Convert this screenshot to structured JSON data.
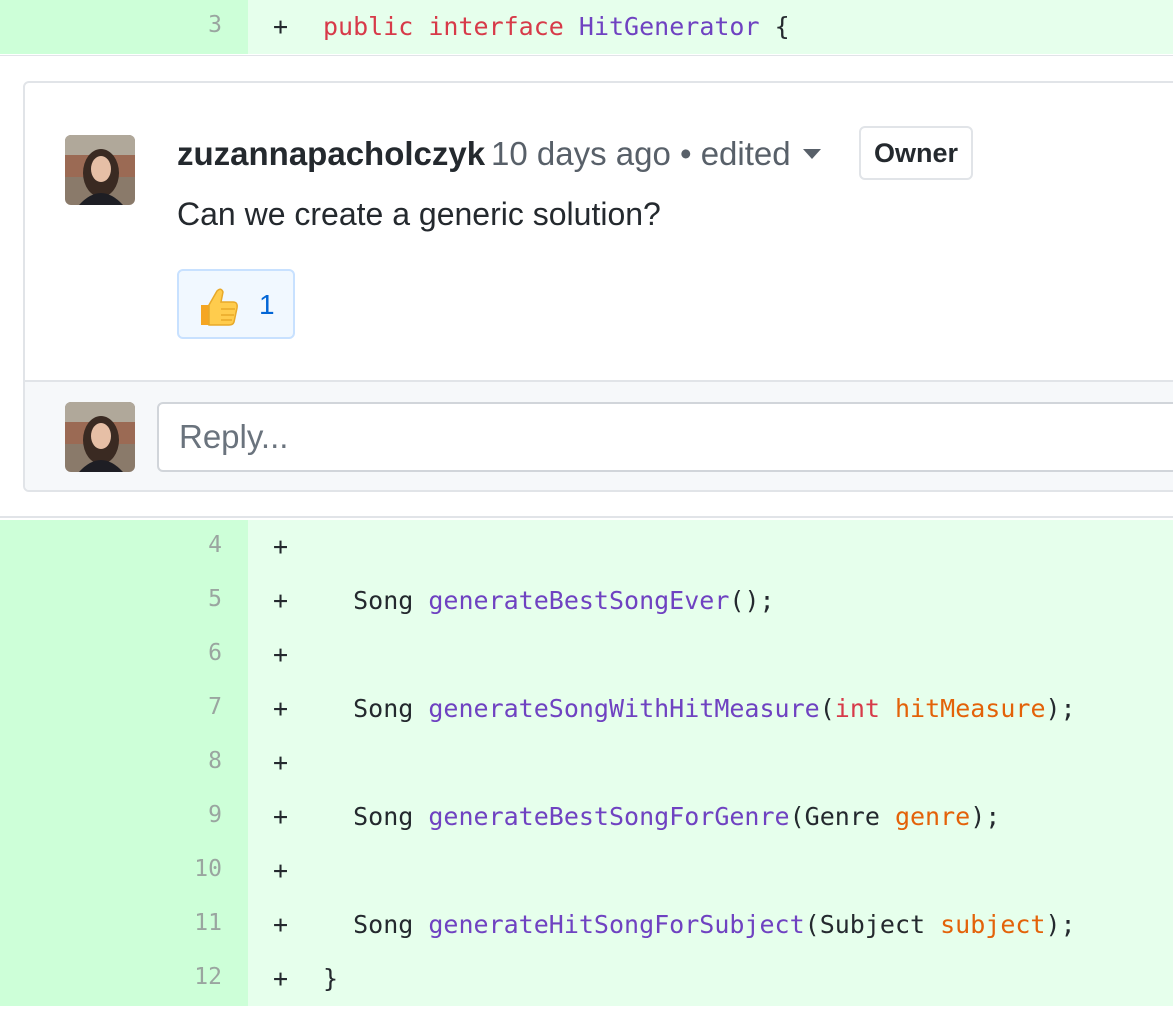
{
  "diff_top": {
    "line_number": "3",
    "marker": "+",
    "tokens": [
      {
        "t": "public",
        "c": "k"
      },
      {
        "t": " ",
        "c": "p"
      },
      {
        "t": "interface",
        "c": "k"
      },
      {
        "t": " ",
        "c": "p"
      },
      {
        "t": "HitGenerator",
        "c": "f"
      },
      {
        "t": " {",
        "c": "p"
      }
    ]
  },
  "comment": {
    "author": "zuzannapacholczyk",
    "meta": "10 days ago • edited",
    "badge": "Owner",
    "body": "Can we create a generic solution?",
    "reaction": {
      "emoji": "thumbs-up",
      "count": "1"
    }
  },
  "reply": {
    "placeholder": "Reply..."
  },
  "diff_rows": [
    {
      "line_number": "4",
      "marker": "+",
      "tokens": []
    },
    {
      "line_number": "5",
      "marker": "+",
      "tokens": [
        {
          "t": "  Song ",
          "c": "p"
        },
        {
          "t": "generateBestSongEver",
          "c": "f"
        },
        {
          "t": "();",
          "c": "p"
        }
      ]
    },
    {
      "line_number": "6",
      "marker": "+",
      "tokens": []
    },
    {
      "line_number": "7",
      "marker": "+",
      "tokens": [
        {
          "t": "  Song ",
          "c": "p"
        },
        {
          "t": "generateSongWithHitMeasure",
          "c": "f"
        },
        {
          "t": "(",
          "c": "p"
        },
        {
          "t": "int",
          "c": "k"
        },
        {
          "t": " ",
          "c": "p"
        },
        {
          "t": "hitMeasure",
          "c": "v"
        },
        {
          "t": ");",
          "c": "p"
        }
      ]
    },
    {
      "line_number": "8",
      "marker": "+",
      "tokens": []
    },
    {
      "line_number": "9",
      "marker": "+",
      "tokens": [
        {
          "t": "  Song ",
          "c": "p"
        },
        {
          "t": "generateBestSongForGenre",
          "c": "f"
        },
        {
          "t": "(Genre ",
          "c": "p"
        },
        {
          "t": "genre",
          "c": "v"
        },
        {
          "t": ");",
          "c": "p"
        }
      ]
    },
    {
      "line_number": "10",
      "marker": "+",
      "tokens": []
    },
    {
      "line_number": "11",
      "marker": "+",
      "tokens": [
        {
          "t": "  Song ",
          "c": "p"
        },
        {
          "t": "generateHitSongForSubject",
          "c": "f"
        },
        {
          "t": "(Subject ",
          "c": "p"
        },
        {
          "t": "subject",
          "c": "v"
        },
        {
          "t": ");",
          "c": "p"
        }
      ]
    },
    {
      "line_number": "12",
      "marker": "+",
      "tokens": [
        {
          "t": "}",
          "c": "p"
        }
      ]
    }
  ],
  "colors": {
    "added_gutter": "#cdffd8",
    "added_code": "#e6ffec",
    "keyword": "#d73a49",
    "function": "#6f42c1",
    "variable": "#e36209",
    "link": "#0366d6"
  }
}
